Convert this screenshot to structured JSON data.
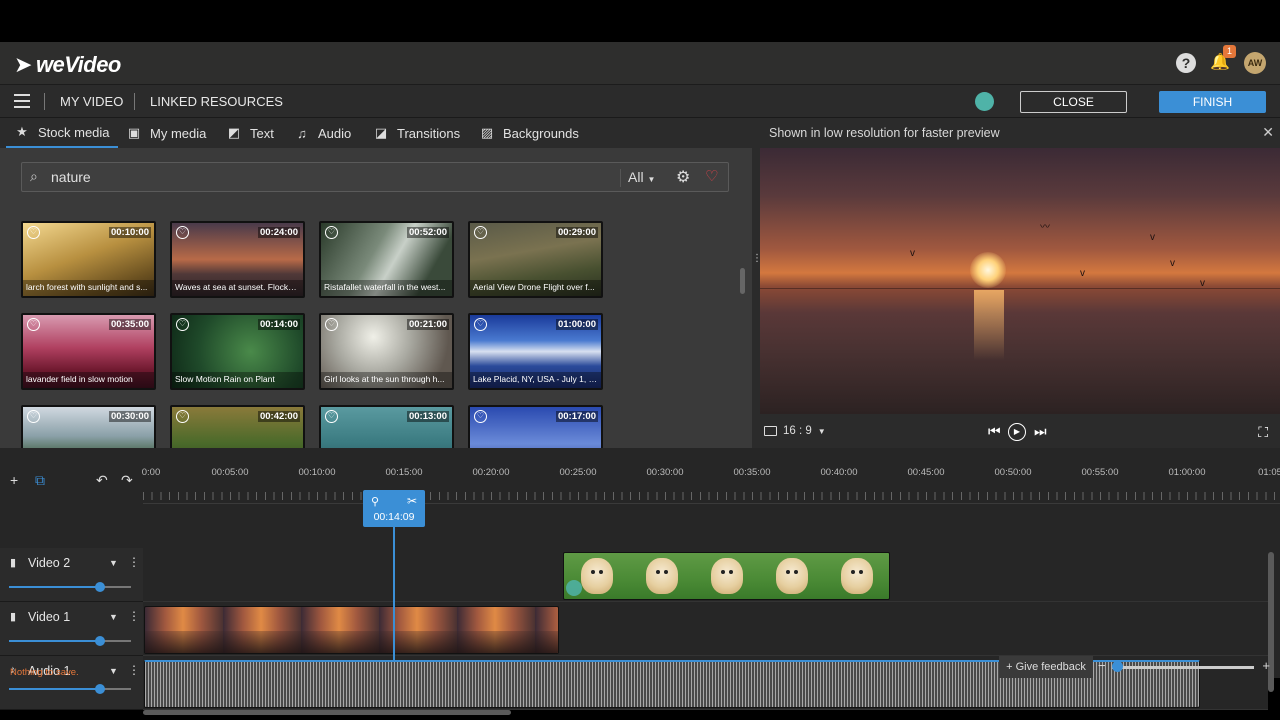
{
  "app": {
    "logo": "weVideo",
    "notification_count": "1",
    "avatar_initials": "AW"
  },
  "menubar": {
    "my_video": "MY VIDEO",
    "linked_resources": "LINKED RESOURCES",
    "close": "CLOSE",
    "finish": "FINISH"
  },
  "tabs": [
    {
      "label": "Stock media",
      "icon": "star-icon"
    },
    {
      "label": "My media",
      "icon": "camera-icon"
    },
    {
      "label": "Text",
      "icon": "text-icon"
    },
    {
      "label": "Audio",
      "icon": "audio-icon"
    },
    {
      "label": "Transitions",
      "icon": "transitions-icon"
    },
    {
      "label": "Backgrounds",
      "icon": "backgrounds-icon"
    }
  ],
  "search": {
    "value": "nature",
    "filter": "All"
  },
  "media": [
    {
      "duration": "00:10:00",
      "caption": "larch forest with sunlight and s..."
    },
    {
      "duration": "00:24:00",
      "caption": "Waves at sea at sunset. Flocks ..."
    },
    {
      "duration": "00:52:00",
      "caption": "Ristafallet waterfall in the west..."
    },
    {
      "duration": "00:29:00",
      "caption": "Aerial View Drone Flight over f..."
    },
    {
      "duration": "00:35:00",
      "caption": "lavander field in slow motion"
    },
    {
      "duration": "00:14:00",
      "caption": "Slow Motion Rain on Plant"
    },
    {
      "duration": "00:21:00",
      "caption": "Girl looks at the sun through h..."
    },
    {
      "duration": "01:00:00",
      "caption": "Lake Placid, NY, USA - July 1, 2..."
    },
    {
      "duration": "00:30:00",
      "caption": ""
    },
    {
      "duration": "00:42:00",
      "caption": ""
    },
    {
      "duration": "00:13:00",
      "caption": ""
    },
    {
      "duration": "00:17:00",
      "caption": ""
    }
  ],
  "preview": {
    "note": "Shown in low resolution for faster preview",
    "aspect": "16 : 9"
  },
  "timeline": {
    "ticks": [
      "0:00",
      "00:05:00",
      "00:10:00",
      "00:15:00",
      "00:20:00",
      "00:25:00",
      "00:30:00",
      "00:35:00",
      "00:40:00",
      "00:45:00",
      "00:50:00",
      "00:55:00",
      "01:00:00",
      "01:05"
    ],
    "playhead_time": "00:14:09",
    "tracks": [
      {
        "name": "Video 2"
      },
      {
        "name": "Video 1"
      },
      {
        "name": "Audio 1"
      }
    ]
  },
  "footer": {
    "status": "Nothing to save.",
    "feedback": "Give feedback"
  }
}
